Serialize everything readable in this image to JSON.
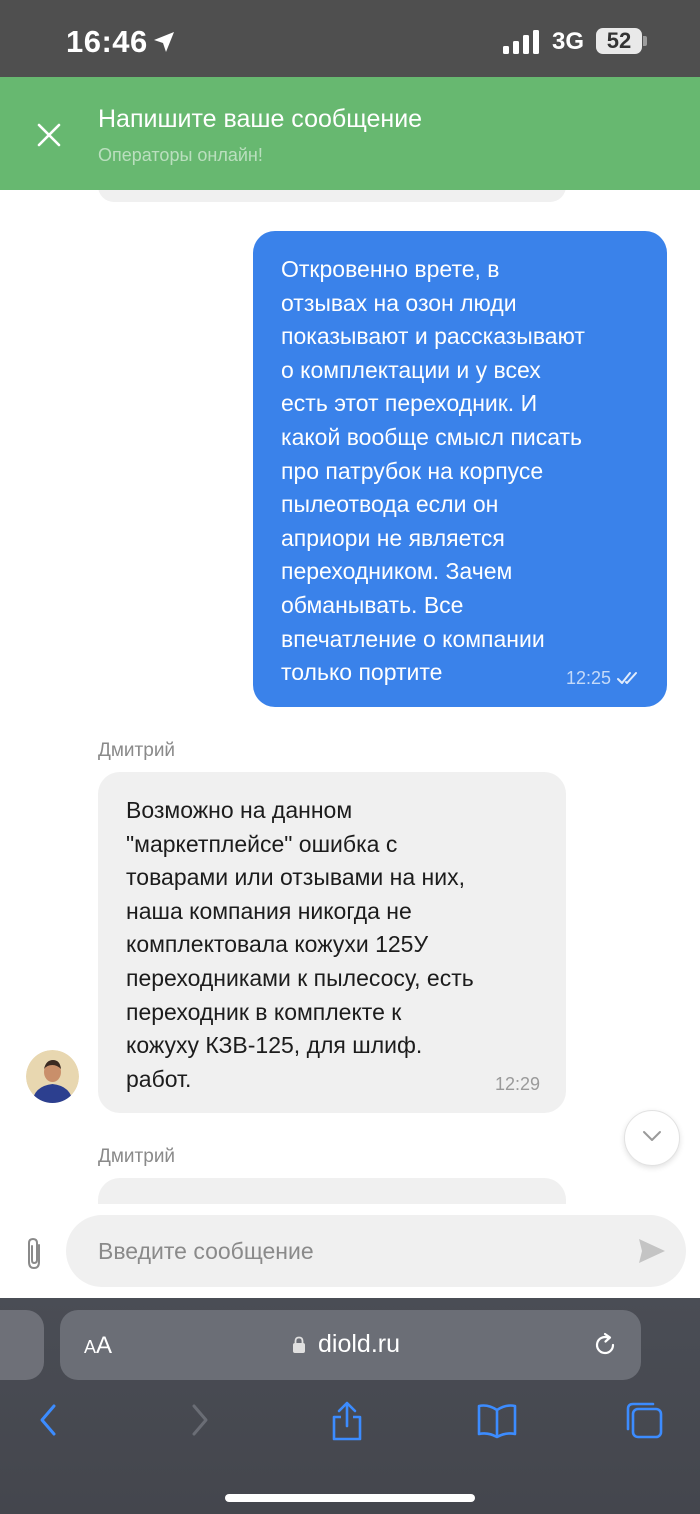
{
  "status_bar": {
    "time": "16:46",
    "network": "3G",
    "battery": "52"
  },
  "chat_header": {
    "title": "Напишите ваше сообщение",
    "subtitle": "Операторы онлайн!",
    "color": "#67b870"
  },
  "messages": [
    {
      "direction": "outgoing",
      "text": "Откровенно врете, в\nотзывах на озон люди\nпоказывают и рассказывают\nо комплектации и у всех\nесть этот переходник. И\nкакой вообще смысл писать\nпро патрубок на корпусе\nпылеотвода если он\nаприори не является\nпереходником. Зачем\nобманывать. Все\nвпечатление о компании\nтолько портите",
      "time": "12:25",
      "status": "read",
      "color": "#3a82ea"
    },
    {
      "direction": "incoming",
      "sender": "Дмитрий",
      "text": "Возможно на данном\n\"маркетплейсе\" ошибка с\nтоварами или отзывами на них,\nнаша компания никогда не\nкомплектовала кожухи 125У\nпереходниками к пылесосу, есть\nпереходник в комплекте к\nкожуху КЗВ-125, для шлиф.\nработ.",
      "time": "12:29"
    },
    {
      "direction": "incoming",
      "sender": "Дмитрий"
    }
  ],
  "composer": {
    "placeholder": "Введите сообщение"
  },
  "browser": {
    "aa_label_big": "A",
    "aa_label_small": "A",
    "url": "diold.ru",
    "toolbar": [
      "back-icon",
      "forward-icon",
      "share-icon",
      "bookmarks-icon",
      "tabs-icon"
    ]
  }
}
